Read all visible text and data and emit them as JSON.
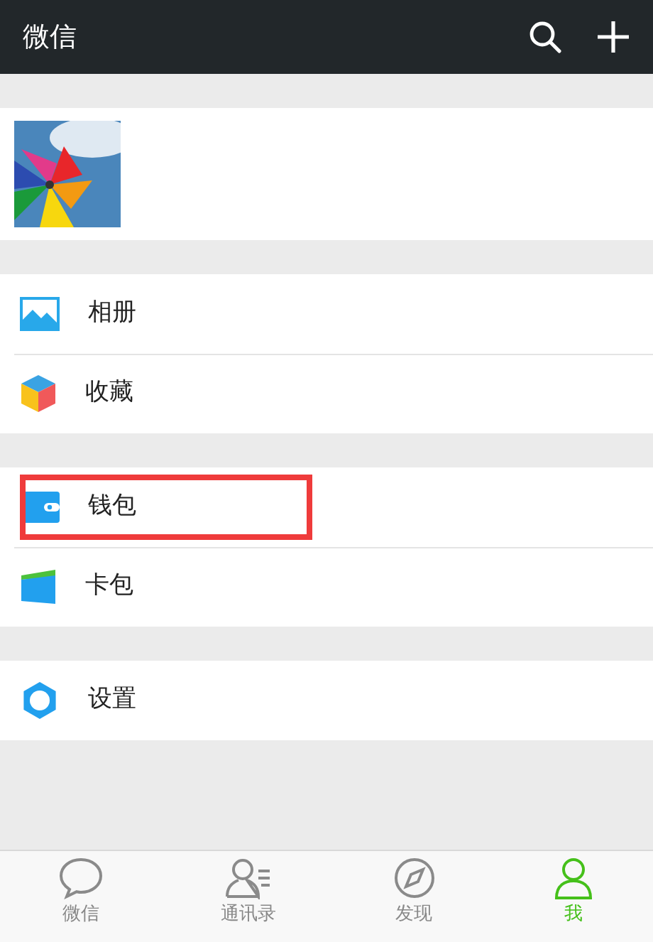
{
  "header": {
    "title": "微信"
  },
  "groups": [
    {
      "items": [
        {
          "label": "相册",
          "highlighted": false
        },
        {
          "label": "收藏",
          "highlighted": false
        }
      ]
    },
    {
      "items": [
        {
          "label": "钱包",
          "highlighted": true
        },
        {
          "label": "卡包",
          "highlighted": false
        }
      ]
    },
    {
      "items": [
        {
          "label": "设置",
          "highlighted": false
        }
      ]
    }
  ],
  "tabs": [
    {
      "label": "微信",
      "selected": false
    },
    {
      "label": "通讯录",
      "selected": false
    },
    {
      "label": "发现",
      "selected": false
    },
    {
      "label": "我",
      "selected": true
    }
  ]
}
